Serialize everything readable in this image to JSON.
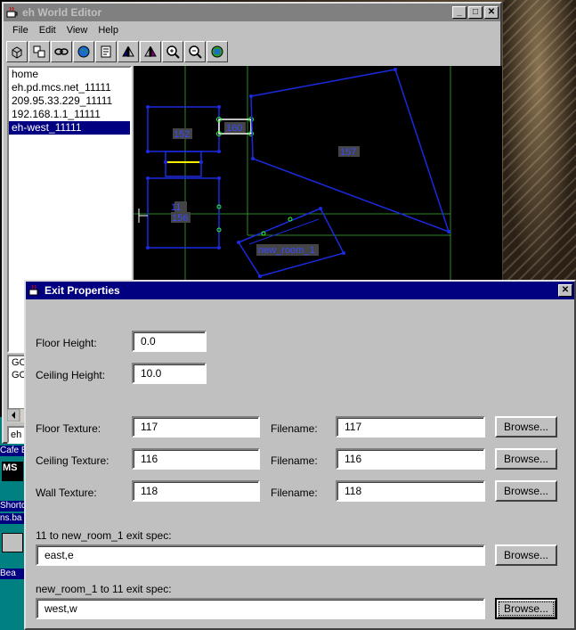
{
  "main_window": {
    "title": "eh World Editor",
    "menu": [
      "File",
      "Edit",
      "View",
      "Help"
    ],
    "toolbar_icons": [
      "cube-icon",
      "rooms-icon",
      "link-icon",
      "globe-icon",
      "properties-icon",
      "mirror-left-icon",
      "mirror-right-icon",
      "zoom-in-icon",
      "zoom-out-icon",
      "world-icon"
    ],
    "tree": [
      "home",
      "eh.pd.mcs.net_11111",
      "209.95.33.229_11111",
      "192.168.1.1_11111",
      "eh-west_11111"
    ],
    "selected_tree_index": 4,
    "lower_list": [
      "GO",
      "GO"
    ],
    "status_text": "eh W",
    "map_labels": {
      "room_152": "152",
      "room_160": "160",
      "room_157": "157",
      "room_11": "11",
      "room_156": "156",
      "room_new": "new_room_1"
    }
  },
  "desktop": {
    "icon_labels": [
      "Cafe B",
      "Shortcu",
      "ns.ba",
      "Bea"
    ],
    "ms_label": "MS"
  },
  "dialog": {
    "title": "Exit Properties",
    "floor_height": {
      "label": "Floor Height:",
      "value": "0.0"
    },
    "ceiling_height": {
      "label": "Ceiling Height:",
      "value": "10.0"
    },
    "floor_texture": {
      "label": "Floor Texture:",
      "value": "117",
      "filename_label": "Filename:",
      "filename": "117",
      "browse": "Browse..."
    },
    "ceiling_texture": {
      "label": "Ceiling Texture:",
      "value": "116",
      "filename_label": "Filename:",
      "filename": "116",
      "browse": "Browse..."
    },
    "wall_texture": {
      "label": "Wall Texture:",
      "value": "118",
      "filename_label": "Filename:",
      "filename": "118",
      "browse": "Browse..."
    },
    "exit_spec_1": {
      "label": "11 to new_room_1 exit spec:",
      "value": "east,e",
      "browse": "Browse..."
    },
    "exit_spec_2": {
      "label": "new_room_1 to 11 exit spec:",
      "value": "west,w",
      "browse": "Browse..."
    }
  }
}
